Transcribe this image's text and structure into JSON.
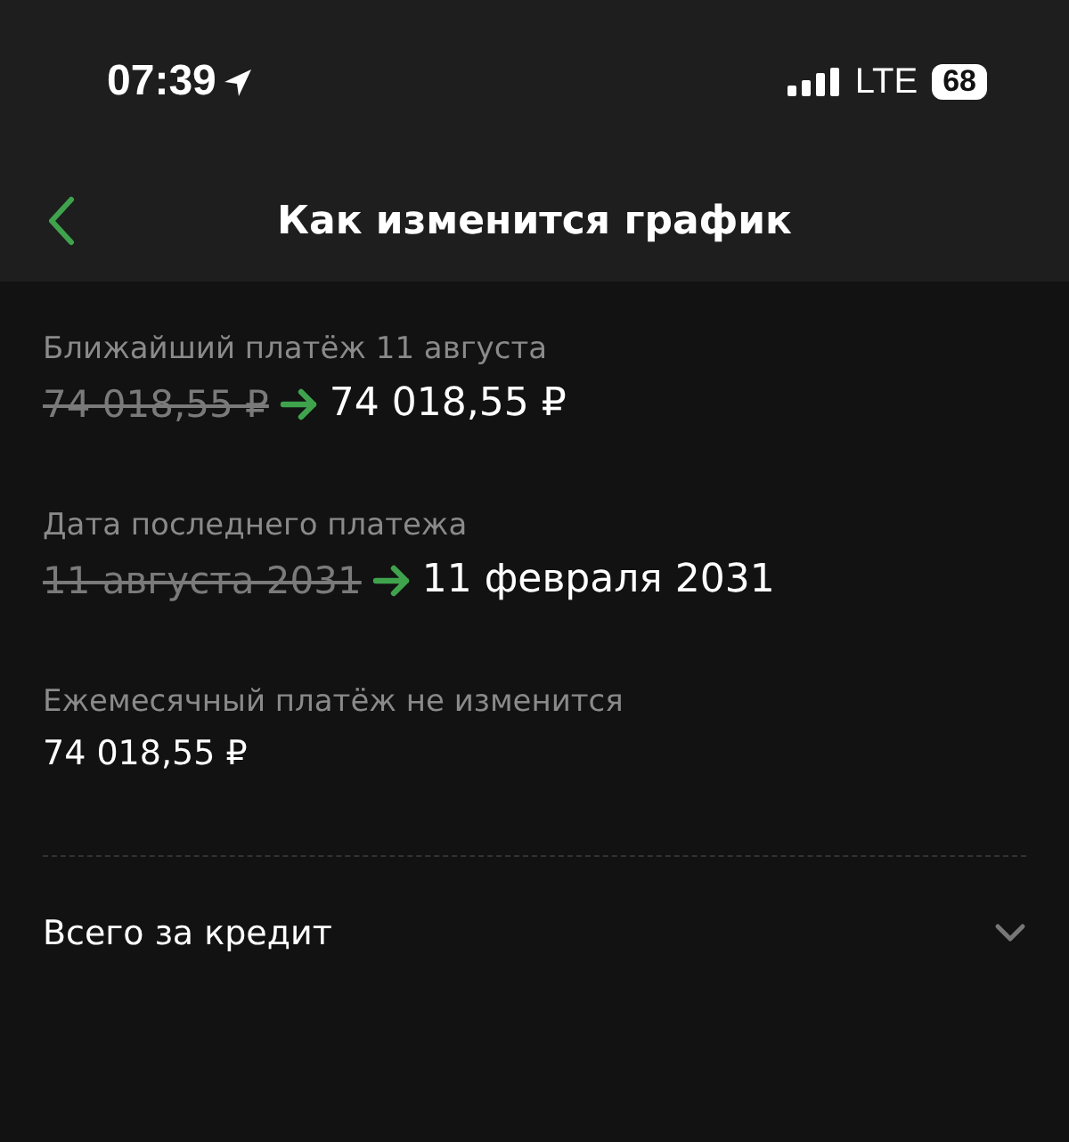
{
  "status_bar": {
    "time": "07:39",
    "network": "LTE",
    "battery": "68"
  },
  "nav": {
    "title": "Как изменится график"
  },
  "items": [
    {
      "kind": "change",
      "label": "Ближайший платёж 11 августа",
      "old_value": "74 018,55 ₽",
      "new_value": "74 018,55 ₽"
    },
    {
      "kind": "change",
      "label": "Дата последнего платежа",
      "old_value": "11 августа 2031",
      "new_value": "11 февраля 2031"
    },
    {
      "kind": "plain",
      "label": "Ежемесячный платёж не изменится",
      "value": "74 018,55 ₽"
    }
  ],
  "expander": {
    "label": "Всего за кредит",
    "expanded": false
  }
}
